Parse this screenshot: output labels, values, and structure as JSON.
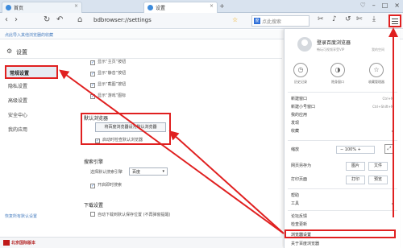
{
  "tabs": [
    {
      "label": "首页"
    },
    {
      "label": "设置"
    }
  ],
  "address": {
    "url": "bdbrowser://settings"
  },
  "search": {
    "placeholder": "点此搜索"
  },
  "bookmarks_bar": {
    "text": "点此导入其他浏览器的收藏"
  },
  "settings": {
    "title": "设置",
    "sidebar": [
      {
        "label": "常规设置"
      },
      {
        "label": "隐私设置"
      },
      {
        "label": "高级设置"
      },
      {
        "label": "安全中心"
      },
      {
        "label": "我的应用"
      }
    ],
    "sidebar_footer": "恢复所有默认设置",
    "toolbar_options": [
      {
        "label": "显示“主页”按钮"
      },
      {
        "label": "显示“静音”按钮"
      },
      {
        "label": "显示“截图”按钮"
      },
      {
        "label": "显示“游戏”图标"
      }
    ],
    "default_browser": {
      "heading": "默认浏览器",
      "button": "将百度浏览器设为默认浏览器",
      "checkbox": "启动时检查默认浏览器"
    },
    "search_engine": {
      "heading": "搜索引擎",
      "label": "选择默认搜索引擎",
      "selected": "百度",
      "checkbox": "开启即时搜索"
    },
    "download": {
      "heading": "下载设置",
      "checkbox": "自动下载到默认保存位置 (不再弹窗提醒)"
    }
  },
  "menu": {
    "login_title": "登录百度浏览器",
    "login_sub": "畅玩可视频享受VIP",
    "login_link": "我的空间",
    "quick": [
      {
        "label": "历史记录",
        "icon": "clock-icon"
      },
      {
        "label": "隐身窗口",
        "icon": "mask-icon"
      },
      {
        "label": "收藏管理器",
        "icon": "star-icon"
      }
    ],
    "items": [
      {
        "label": "新建窗口",
        "shortcut": "Ctrl+N"
      },
      {
        "label": "新建小号窗口",
        "shortcut": "Ctrl+Shift+N"
      },
      {
        "label": "我的应用",
        "shortcut": ""
      },
      {
        "label": "发现",
        "shortcut": ""
      },
      {
        "label": "收藏",
        "shortcut": "▸"
      }
    ],
    "zoom_label": "缩放",
    "zoom_value": "100%",
    "save_label": "网页另存为",
    "save_image": "图片",
    "save_file": "文件",
    "print_label": "打印页面",
    "print_btn": "打印",
    "print_preview": "预览",
    "help_label": "帮助",
    "tools_label": "工具",
    "forum_label": "论坛反馈",
    "update_label": "检查更新",
    "settings_label": "浏览器设置",
    "about_label": "关于百度浏览器"
  },
  "status": {
    "brand": "北京国际版本"
  },
  "colors": {
    "highlight": "#e02020",
    "link": "#4a7fc0"
  }
}
